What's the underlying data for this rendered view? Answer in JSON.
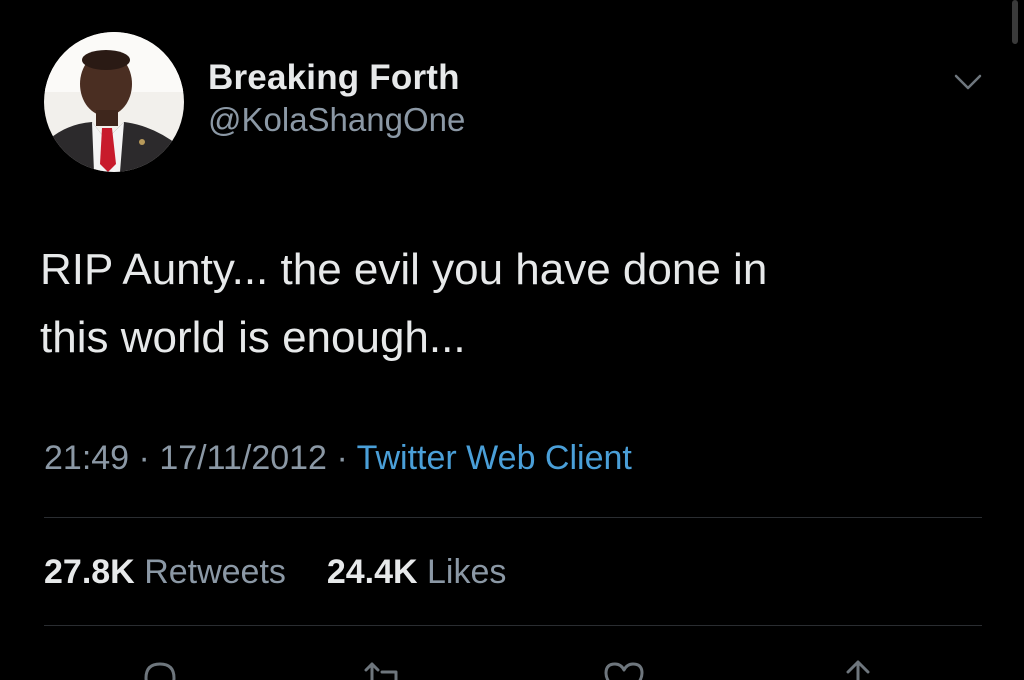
{
  "tweet": {
    "author": {
      "display_name": "Breaking Forth",
      "handle": "@KolaShangOne"
    },
    "text": "RIP Aunty... the evil you have done in\nthis world is enough...",
    "time": "21:49",
    "separator": "·",
    "date": "17/11/2012",
    "source": "Twitter Web Client",
    "stats": {
      "retweets_count": "27.8K",
      "retweets_label": "Retweets",
      "likes_count": "24.4K",
      "likes_label": "Likes"
    }
  },
  "icons": {
    "caret": "chevron-down-icon",
    "reply": "reply-icon",
    "retweet": "retweet-icon",
    "like": "heart-icon",
    "share": "share-icon"
  },
  "colors": {
    "background": "#000000",
    "text_primary": "#e7e9ea",
    "text_secondary": "#8b98a5",
    "link": "#4a9fd8",
    "divider": "#2a2d31"
  }
}
